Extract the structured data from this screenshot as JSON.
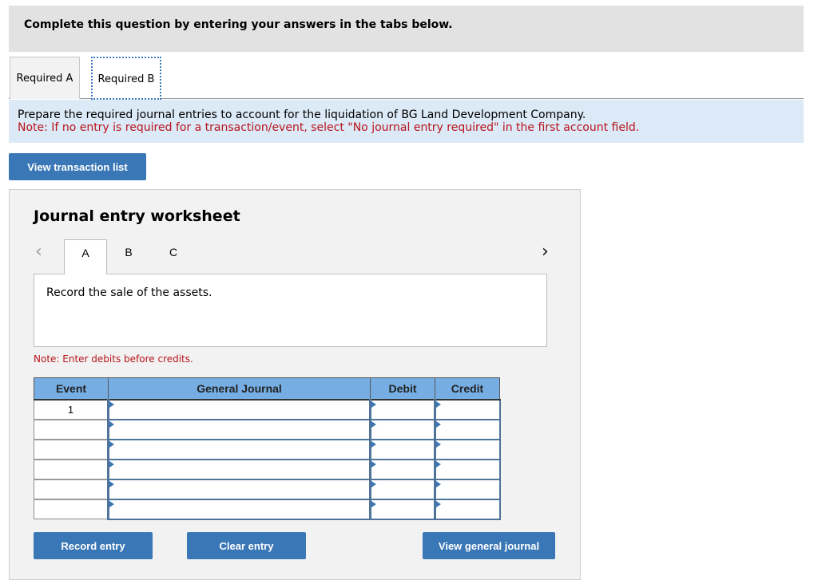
{
  "instructions": {
    "text": "Complete this question by entering your answers in the tabs below."
  },
  "tabs": [
    {
      "label": "Required A",
      "active": false
    },
    {
      "label": "Required B",
      "active": true
    }
  ],
  "prompt": {
    "text": "Prepare the required journal entries to account for the liquidation of BG Land Development Company.",
    "note": "Note: If no entry is required for a transaction/event, select \"No journal entry required\" in the first account field."
  },
  "buttons": {
    "view_transaction_list": "View transaction list",
    "record_entry": "Record entry",
    "clear_entry": "Clear entry",
    "view_general_journal": "View general journal"
  },
  "worksheet": {
    "title": "Journal entry worksheet",
    "prev_icon": "<",
    "next_icon": ">",
    "tabs": [
      "A",
      "B",
      "C"
    ],
    "active_tab": "A",
    "description": "Record the sale of the assets.",
    "note": "Note: Enter debits before credits."
  },
  "journal": {
    "headers": {
      "event": "Event",
      "general_journal": "General Journal",
      "debit": "Debit",
      "credit": "Credit"
    },
    "rows": [
      {
        "event": "1",
        "account": "",
        "debit": "",
        "credit": ""
      },
      {
        "event": "",
        "account": "",
        "debit": "",
        "credit": ""
      },
      {
        "event": "",
        "account": "",
        "debit": "",
        "credit": ""
      },
      {
        "event": "",
        "account": "",
        "debit": "",
        "credit": ""
      },
      {
        "event": "",
        "account": "",
        "debit": "",
        "credit": ""
      },
      {
        "event": "",
        "account": "",
        "debit": "",
        "credit": ""
      }
    ]
  },
  "colors": {
    "accent_button": "#3a77b6",
    "table_header": "#76aee3",
    "note_red": "#b8141c",
    "prompt_bg": "#dce9f6"
  }
}
